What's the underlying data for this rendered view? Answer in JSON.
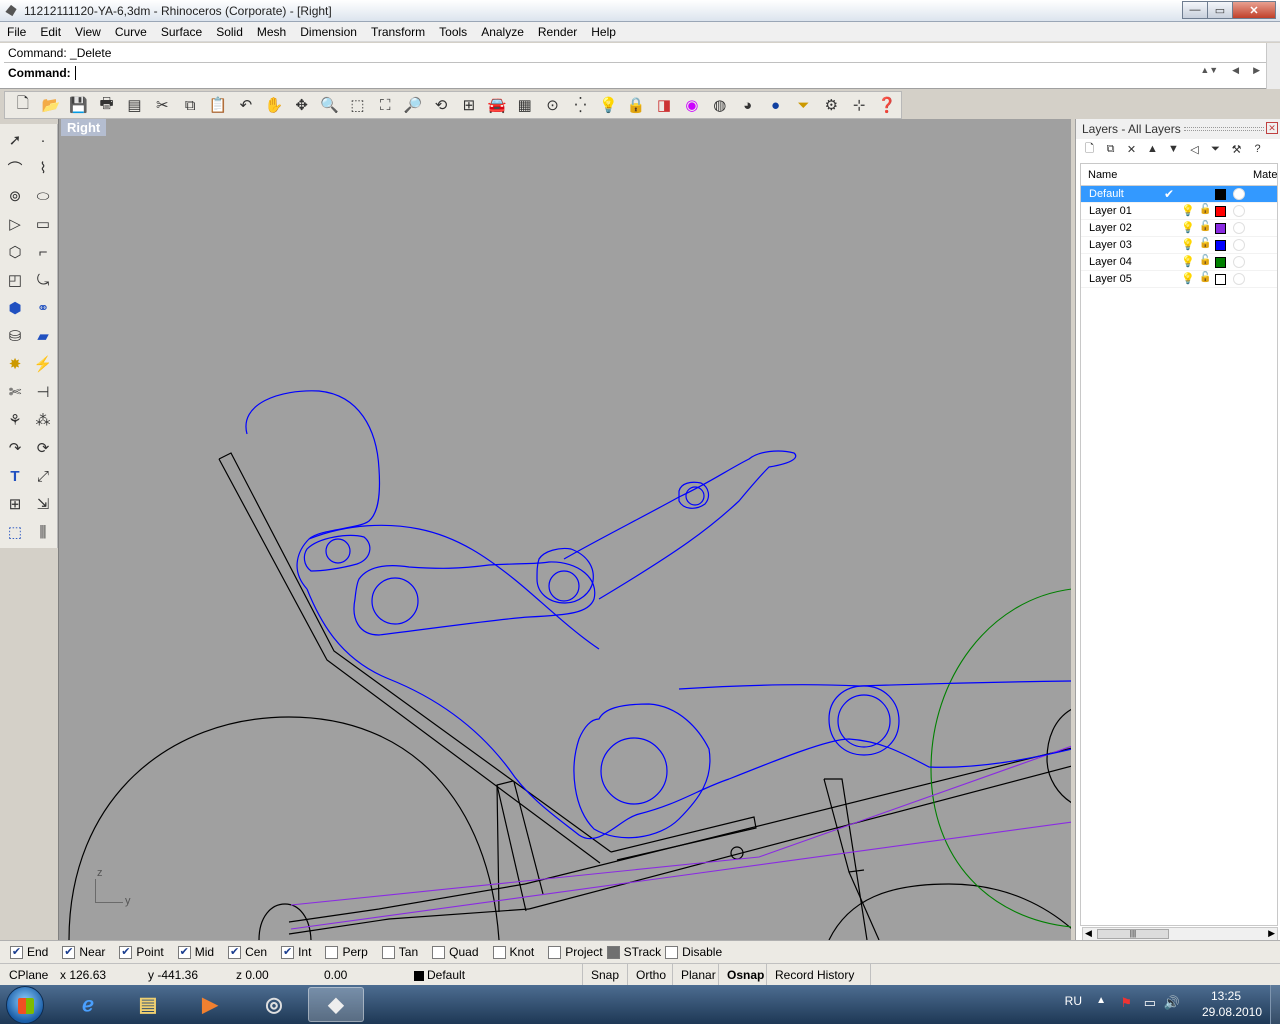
{
  "window": {
    "title": "11212111120-YA-6,3dm - Rhinoceros (Corporate) - [Right]",
    "min": "—",
    "max": "▭",
    "close": "✕"
  },
  "menu": [
    "File",
    "Edit",
    "View",
    "Curve",
    "Surface",
    "Solid",
    "Mesh",
    "Dimension",
    "Transform",
    "Tools",
    "Analyze",
    "Render",
    "Help"
  ],
  "command": {
    "history": "Command: _Delete",
    "prompt": "Command:"
  },
  "viewport": {
    "title": "Right",
    "axis_z": "z",
    "axis_y": "y",
    "colors": {
      "background": "#a0a0a0",
      "layer_default": "#000000",
      "layer_01": "#ff0000",
      "layer_02": "#8a2be2",
      "layer_03": "#0000ff",
      "layer_04": "#008000"
    }
  },
  "layers": {
    "title": "Layers - All Layers",
    "col_name": "Name",
    "col_material": "Mater",
    "rows": [
      {
        "name": "Default",
        "current": "✔",
        "color": "#000000",
        "selected": true
      },
      {
        "name": "Layer 01",
        "current": "",
        "color": "#ff0000",
        "selected": false
      },
      {
        "name": "Layer 02",
        "current": "",
        "color": "#8a2be2",
        "selected": false
      },
      {
        "name": "Layer 03",
        "current": "",
        "color": "#0000ff",
        "selected": false
      },
      {
        "name": "Layer 04",
        "current": "",
        "color": "#008000",
        "selected": false
      },
      {
        "name": "Layer 05",
        "current": "",
        "color": "#ffffff",
        "selected": false
      }
    ]
  },
  "osnap": [
    {
      "label": "End",
      "checked": true
    },
    {
      "label": "Near",
      "checked": true
    },
    {
      "label": "Point",
      "checked": true
    },
    {
      "label": "Mid",
      "checked": true
    },
    {
      "label": "Cen",
      "checked": true
    },
    {
      "label": "Int",
      "checked": true
    },
    {
      "label": "Perp",
      "checked": false
    },
    {
      "label": "Tan",
      "checked": false
    },
    {
      "label": "Quad",
      "checked": false
    },
    {
      "label": "Knot",
      "checked": false
    },
    {
      "label": "Project",
      "checked": false
    },
    {
      "label": "STrack",
      "checked": false
    },
    {
      "label": "Disable",
      "checked": false
    }
  ],
  "status": {
    "cplane": "CPlane",
    "x": "x 126.63",
    "y": "y -441.36",
    "z": "z 0.00",
    "d": "0.00",
    "layer": "Default",
    "snap": "Snap",
    "ortho": "Ortho",
    "planar": "Planar",
    "osnap": "Osnap",
    "record": "Record History"
  },
  "taskbar": {
    "lang": "RU",
    "time": "13:25",
    "date": "29.08.2010"
  }
}
